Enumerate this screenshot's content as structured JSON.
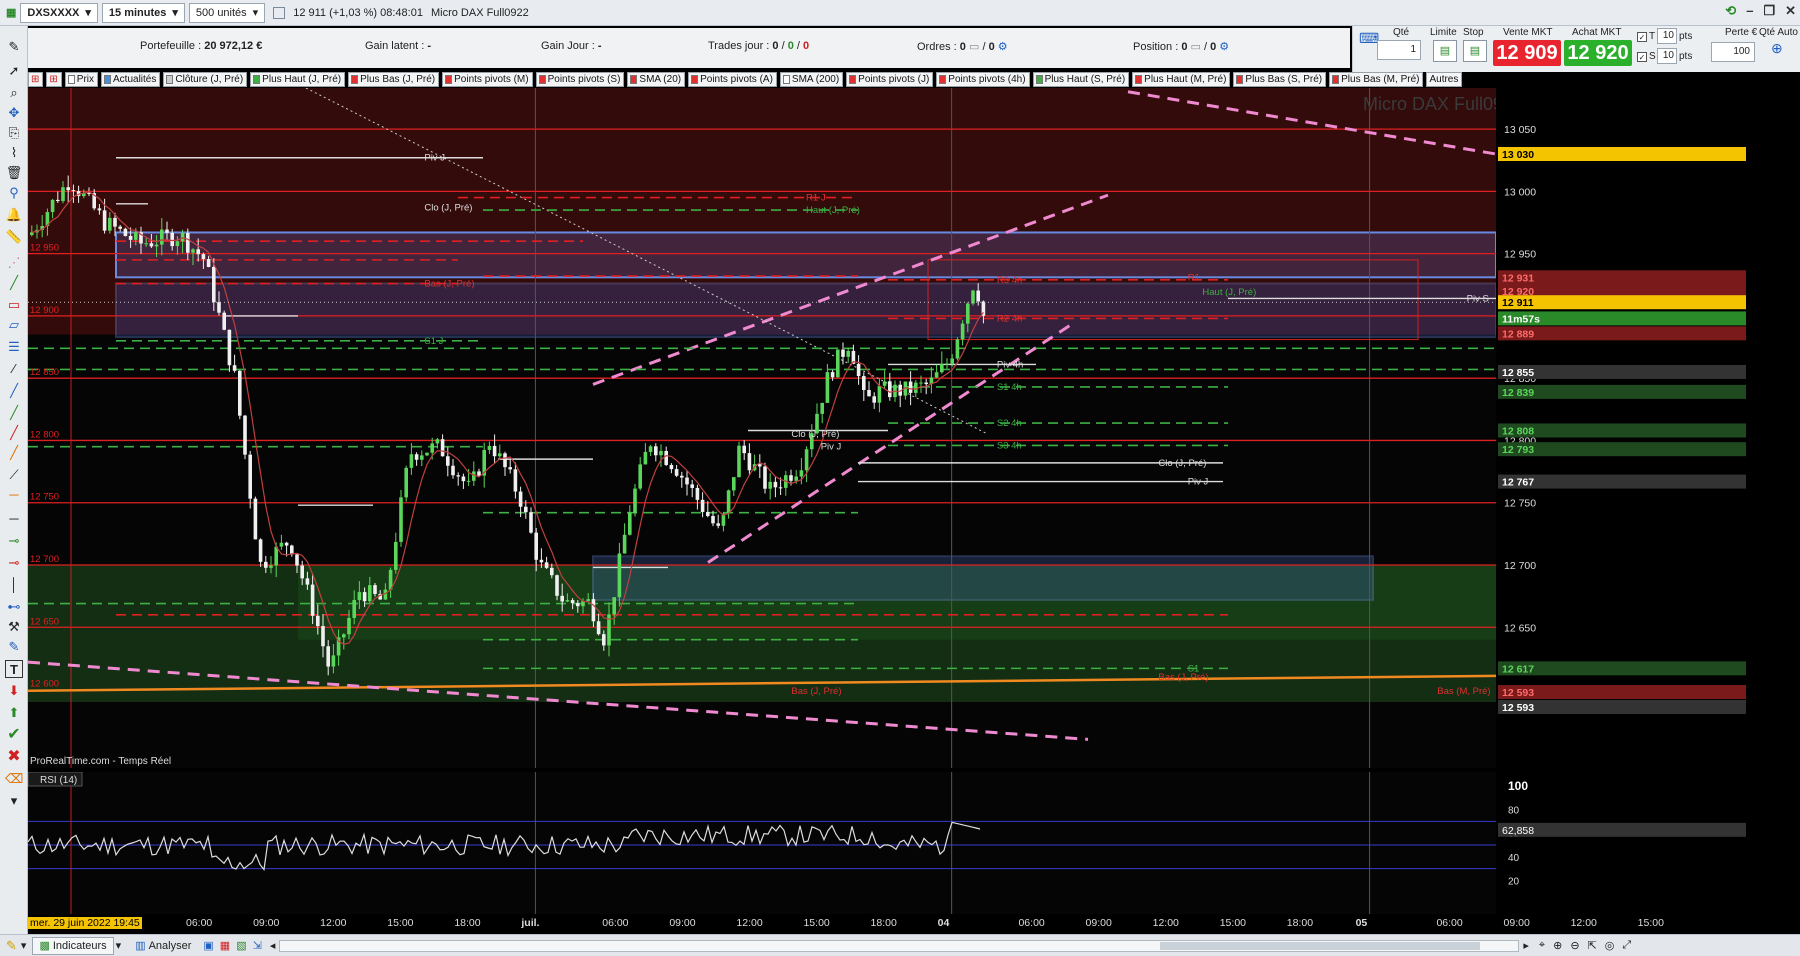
{
  "titlebar": {
    "symbol": "DXSXXXX",
    "timeframe": "15 minutes",
    "units": "500 unités",
    "price": "12 911 (+1,03 %) 08:48:01",
    "instrument": "Micro DAX Full0922"
  },
  "portfolio": {
    "portefeuille_label": "Portefeuille :",
    "portefeuille_value": "20 972,12 €",
    "gain_latent_label": "Gain latent :",
    "gain_latent_value": "-",
    "gain_jour_label": "Gain Jour :",
    "gain_jour_value": "-",
    "trades_label": "Trades jour :",
    "trades_values": [
      "0",
      "0",
      "0"
    ],
    "ordres_label": "Ordres :",
    "ordres_values": [
      "0",
      "0"
    ],
    "position_label": "Position :",
    "position_values": [
      "0",
      "0"
    ]
  },
  "trade_panel": {
    "qte_label": "Qté",
    "qte_value": "1",
    "limite_label": "Limite",
    "stop_label": "Stop",
    "vente_label": "Vente MKT",
    "vente_price": "12 909",
    "achat_label": "Achat MKT",
    "achat_price": "12 920",
    "t_label": "T",
    "t_value": "10",
    "t_unit": "pts",
    "s_label": "S",
    "s_value": "10",
    "s_unit": "pts",
    "perte_label": "Perte €",
    "qte_auto_label": "Qté Auto",
    "qte_auto_value": "100"
  },
  "indicators": [
    {
      "label": "Prix",
      "color": "#ffffff"
    },
    {
      "label": "Actualités",
      "color": "#4a90d9"
    },
    {
      "label": "Clôture (J, Pré)",
      "color": "#cccccc"
    },
    {
      "label": "Plus Haut (J, Pré)",
      "color": "#3cb043"
    },
    {
      "label": "Plus Bas (J, Pré)",
      "color": "#e03030"
    },
    {
      "label": "Points pivots (M)",
      "color": "#e03030"
    },
    {
      "label": "Points pivots (S)",
      "color": "#e03030"
    },
    {
      "label": "SMA (20)",
      "color": "#e03030"
    },
    {
      "label": "Points pivots (A)",
      "color": "#e03030"
    },
    {
      "label": "SMA (200)",
      "color": "#ffffff"
    },
    {
      "label": "Points pivots (J)",
      "color": "#e03030"
    },
    {
      "label": "Points pivots (4h)",
      "color": "#e03030"
    },
    {
      "label": "Plus Haut (S, Pré)",
      "color": "#3cb043"
    },
    {
      "label": "Plus Haut (M, Pré)",
      "color": "#e03030"
    },
    {
      "label": "Plus Bas (S, Pré)",
      "color": "#e03030"
    },
    {
      "label": "Plus Bas (M, Pré)",
      "color": "#e03030"
    },
    {
      "label": "Autres",
      "color": ""
    }
  ],
  "chart": {
    "watermark": "Micro DAX Full0922",
    "source": "ProRealTime.com - Temps Réel",
    "ytick_labels": [
      "13 050",
      "13 000",
      "12 950",
      "12 900",
      "12 850",
      "12 800",
      "12 750",
      "12 700",
      "12 650"
    ],
    "left_labels": [
      "12 950",
      "12 900",
      "12 850",
      "12 800",
      "12 750",
      "12 700",
      "12 650",
      "12 600"
    ],
    "price_tags": [
      {
        "text": "13 030",
        "price": 13030,
        "bg": "#f5c400",
        "fg": "#000"
      },
      {
        "text": "12 931",
        "price": 12931,
        "bg": "#7a1a1a",
        "fg": "#ff6a6a"
      },
      {
        "text": "12 920",
        "price": 12920,
        "bg": "#7a1a1a",
        "fg": "#ff6a6a"
      },
      {
        "text": "12 911",
        "price": 12911,
        "bg": "#f5c400",
        "fg": "#000"
      },
      {
        "text": "11m57s",
        "price": 12898,
        "bg": "#2a8a2a",
        "fg": "#fff"
      },
      {
        "text": "12 889",
        "price": 12886,
        "bg": "#7a1a1a",
        "fg": "#ff6a6a"
      },
      {
        "text": "12 855",
        "price": 12855,
        "bg": "#333",
        "fg": "#fff"
      },
      {
        "text": "12 839",
        "price": 12839,
        "bg": "#1f4a1f",
        "fg": "#5ad65a"
      },
      {
        "text": "12 808",
        "price": 12808,
        "bg": "#1f4a1f",
        "fg": "#5ad65a"
      },
      {
        "text": "12 793",
        "price": 12793,
        "bg": "#1f4a1f",
        "fg": "#5ad65a"
      },
      {
        "text": "12 767",
        "price": 12767,
        "bg": "#333",
        "fg": "#fff"
      },
      {
        "text": "12 617",
        "price": 12617,
        "bg": "#1f4a1f",
        "fg": "#5ad65a"
      },
      {
        "text": "12 593",
        "price": 12598,
        "bg": "#7a1a1a",
        "fg": "#ff6a6a"
      },
      {
        "text": "12 593",
        "price": 12586,
        "bg": "#333",
        "fg": "#fff"
      }
    ],
    "annotations": [
      {
        "text": "Piv J",
        "price": 13027,
        "side": "left",
        "x": 0.27,
        "color": "#dddddd"
      },
      {
        "text": "Clo (J, Pré)",
        "price": 12987,
        "side": "left",
        "x": 0.27,
        "color": "#dddddd"
      },
      {
        "text": "R1 J",
        "price": 12995,
        "side": "left",
        "x": 0.53,
        "color": "#e03030"
      },
      {
        "text": "Haut (J, Pré)",
        "price": 12985,
        "side": "left",
        "x": 0.53,
        "color": "#3cb043"
      },
      {
        "text": "Bas (J, Pré)",
        "price": 12926,
        "side": "left",
        "x": 0.27,
        "color": "#e03030"
      },
      {
        "text": "S1 J",
        "price": 12880,
        "side": "left",
        "x": 0.27,
        "color": "#3cb043"
      },
      {
        "text": "R3 4h",
        "price": 12929,
        "side": "left",
        "x": 0.66,
        "color": "#e03030"
      },
      {
        "text": "Haut (J, Pré)",
        "price": 12919,
        "side": "left",
        "x": 0.8,
        "color": "#3cb043"
      },
      {
        "text": "R2 4h",
        "price": 12898,
        "side": "left",
        "x": 0.66,
        "color": "#e03030"
      },
      {
        "text": "R1",
        "price": 12931,
        "side": "left",
        "x": 0.79,
        "color": "#e03030"
      },
      {
        "text": "Piv S",
        "price": 12914,
        "side": "left",
        "x": 0.98,
        "color": "#dddddd"
      },
      {
        "text": "Piv 4h",
        "price": 12861,
        "side": "left",
        "x": 0.66,
        "color": "#dddddd"
      },
      {
        "text": "S1 4h",
        "price": 12843,
        "side": "left",
        "x": 0.66,
        "color": "#3cb043"
      },
      {
        "text": "S2 4h",
        "price": 12814,
        "side": "left",
        "x": 0.66,
        "color": "#3cb043"
      },
      {
        "text": "S3 4h",
        "price": 12796,
        "side": "left",
        "x": 0.66,
        "color": "#3cb043"
      },
      {
        "text": "Clo (J, Pré)",
        "price": 12805,
        "side": "left",
        "x": 0.52,
        "color": "#dddddd"
      },
      {
        "text": "Piv J",
        "price": 12795,
        "side": "left",
        "x": 0.54,
        "color": "#dddddd"
      },
      {
        "text": "Clo (J, Pré)",
        "price": 12782,
        "side": "left",
        "x": 0.77,
        "color": "#dddddd"
      },
      {
        "text": "Piv J",
        "price": 12767,
        "side": "left",
        "x": 0.79,
        "color": "#dddddd"
      },
      {
        "text": "Bas (J, Pré)",
        "price": 12599,
        "side": "left",
        "x": 0.52,
        "color": "#e03030"
      },
      {
        "text": "Bas (J, Pré)",
        "price": 12610,
        "side": "left",
        "x": 0.77,
        "color": "#e03030"
      },
      {
        "text": "Bas (M, Pré)",
        "price": 12599,
        "side": "left",
        "x": 0.96,
        "color": "#e03030"
      },
      {
        "text": "S1",
        "price": 12617,
        "side": "left",
        "x": 0.79,
        "color": "#3cb043"
      }
    ],
    "x_labels": [
      {
        "text": "mer. 29 juin 2022 19:45",
        "t": 0.0,
        "hl": true
      },
      {
        "text": "06:00",
        "t": 0.1
      },
      {
        "text": "09:00",
        "t": 0.139
      },
      {
        "text": "12:00",
        "t": 0.178
      },
      {
        "text": "15:00",
        "t": 0.217
      },
      {
        "text": "18:00",
        "t": 0.256
      },
      {
        "text": "juil.",
        "t": 0.295,
        "bold": true
      },
      {
        "text": "06:00",
        "t": 0.342
      },
      {
        "text": "09:00",
        "t": 0.381
      },
      {
        "text": "12:00",
        "t": 0.42
      },
      {
        "text": "15:00",
        "t": 0.459
      },
      {
        "text": "18:00",
        "t": 0.498
      },
      {
        "text": "04",
        "t": 0.537,
        "bold": true
      },
      {
        "text": "06:00",
        "t": 0.584
      },
      {
        "text": "09:00",
        "t": 0.623
      },
      {
        "text": "12:00",
        "t": 0.662
      },
      {
        "text": "15:00",
        "t": 0.701
      },
      {
        "text": "18:00",
        "t": 0.74
      },
      {
        "text": "05",
        "t": 0.78,
        "bold": true
      },
      {
        "text": "06:00",
        "t": 0.827
      },
      {
        "text": "09:00",
        "t": 0.866
      },
      {
        "text": "12:00",
        "t": 0.905
      },
      {
        "text": "15:00",
        "t": 0.944
      }
    ]
  },
  "rsi": {
    "label": "RSI (14)",
    "value_tag": "62,858",
    "levels": [
      "100",
      "80",
      "60",
      "40",
      "20"
    ]
  },
  "bottombar": {
    "indicateurs": "Indicateurs",
    "analyser": "Analyser"
  }
}
